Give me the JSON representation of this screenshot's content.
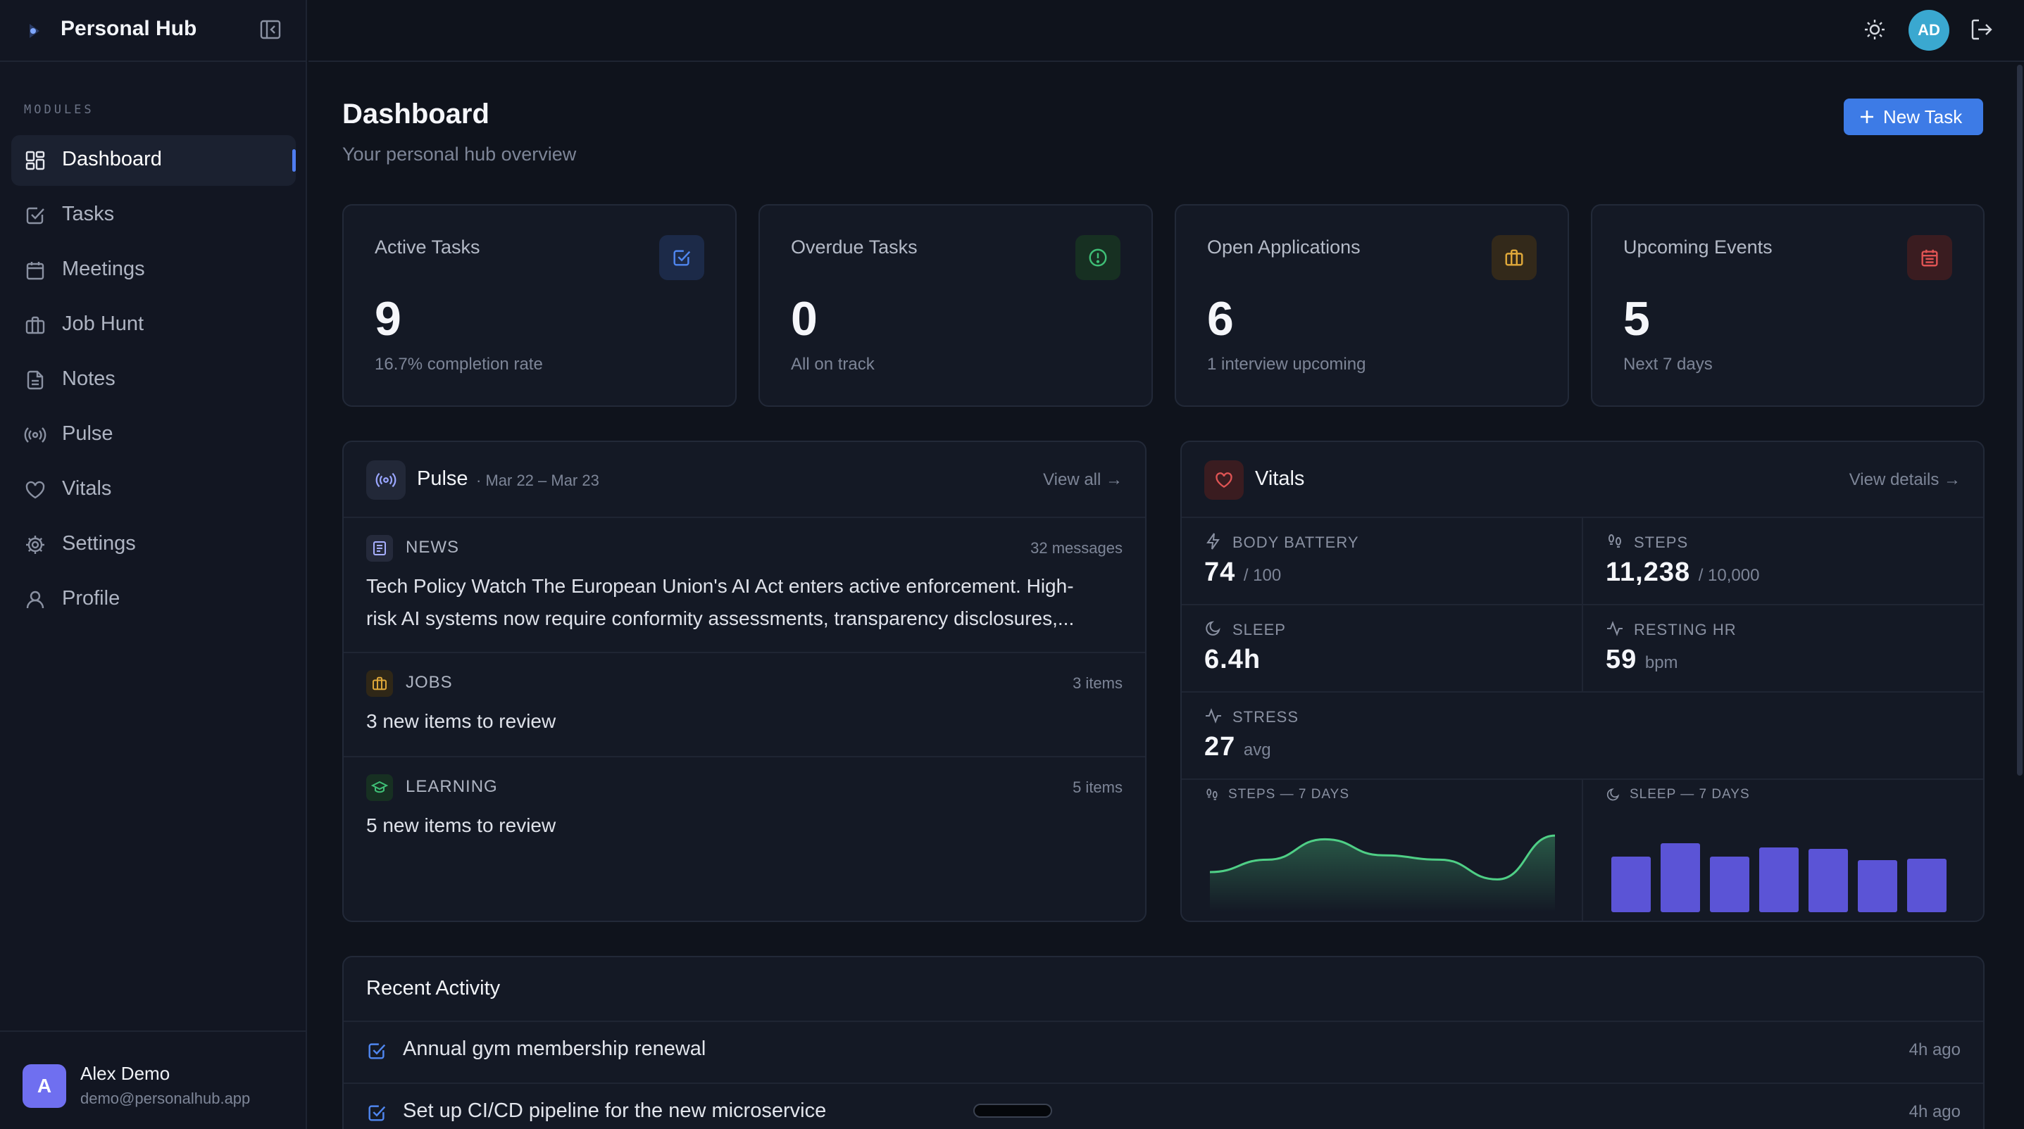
{
  "app": {
    "name": "Personal Hub"
  },
  "sidebar": {
    "section_label": "MODULES",
    "items": [
      {
        "label": "Dashboard",
        "icon": "dashboard-icon",
        "active": true
      },
      {
        "label": "Tasks",
        "icon": "check-square-icon"
      },
      {
        "label": "Meetings",
        "icon": "calendar-icon"
      },
      {
        "label": "Job Hunt",
        "icon": "briefcase-icon"
      },
      {
        "label": "Notes",
        "icon": "file-text-icon"
      },
      {
        "label": "Pulse",
        "icon": "radio-icon"
      },
      {
        "label": "Vitals",
        "icon": "heart-icon"
      },
      {
        "label": "Settings",
        "icon": "gear-icon"
      },
      {
        "label": "Profile",
        "icon": "user-icon"
      }
    ],
    "user": {
      "initial": "A",
      "name": "Alex Demo",
      "email": "demo@personalhub.app"
    }
  },
  "topbar": {
    "avatar_initials": "AD"
  },
  "header": {
    "title": "Dashboard",
    "subtitle": "Your personal hub overview",
    "new_task_label": "New Task"
  },
  "stats": [
    {
      "title": "Active Tasks",
      "value": "9",
      "sub": "16.7% completion rate",
      "icon": "check-square-icon",
      "color": "#4f86f0"
    },
    {
      "title": "Overdue Tasks",
      "value": "0",
      "sub": "All on track",
      "icon": "alert-circle-icon",
      "color": "#3fbf76"
    },
    {
      "title": "Open Applications",
      "value": "6",
      "sub": "1 interview upcoming",
      "icon": "briefcase-icon",
      "color": "#e0a93a"
    },
    {
      "title": "Upcoming Events",
      "value": "5",
      "sub": "Next 7 days",
      "icon": "calendar-icon",
      "color": "#e05454"
    }
  ],
  "pulse": {
    "title": "Pulse",
    "date_range": "· Mar 22 – Mar 23",
    "view_all": "View all →",
    "feeds": [
      {
        "category": "NEWS",
        "count": "32 messages",
        "line1": "Tech Policy Watch The European Union's AI Act enters active enforcement. High-",
        "line2": "risk AI systems now require conformity assessments, transparency disclosures,..."
      },
      {
        "category": "JOBS",
        "count": "3 items",
        "line1": "3 new items to review"
      },
      {
        "category": "LEARNING",
        "count": "5 items",
        "line1": "5 new items to review"
      }
    ]
  },
  "vitals": {
    "title": "Vitals",
    "view_details": "View details →",
    "body_battery": {
      "label": "BODY BATTERY",
      "value": "74",
      "unit": "/ 100"
    },
    "steps": {
      "label": "STEPS",
      "value": "11,238",
      "unit": "/ 10,000"
    },
    "sleep": {
      "label": "SLEEP",
      "value": "6.4h"
    },
    "resting_hr": {
      "label": "RESTING HR",
      "value": "59",
      "unit": "bpm"
    },
    "stress": {
      "label": "STRESS",
      "value": "27",
      "unit": "avg"
    },
    "steps_chart_label": "STEPS — 7 DAYS",
    "sleep_chart_label": "SLEEP — 7 DAYS"
  },
  "chart_data": [
    {
      "type": "area",
      "title": "STEPS — 7 DAYS",
      "values": [
        0.55,
        0.72,
        1.0,
        0.78,
        0.72,
        0.45,
        1.05
      ]
    },
    {
      "type": "bar",
      "title": "SLEEP — 7 DAYS",
      "values": [
        0.79,
        0.98,
        0.79,
        0.92,
        0.9,
        0.74,
        0.76
      ]
    }
  ],
  "activity": {
    "title": "Recent Activity",
    "items": [
      {
        "text": "Annual gym membership renewal",
        "time": "4h ago"
      },
      {
        "text": "Set up CI/CD pipeline for the new microservice",
        "time": "4h ago"
      }
    ]
  },
  "colors": {
    "accent": "#3d7be6",
    "steps_line": "#4fcf86",
    "sleep_bars": "#5b54d6"
  }
}
